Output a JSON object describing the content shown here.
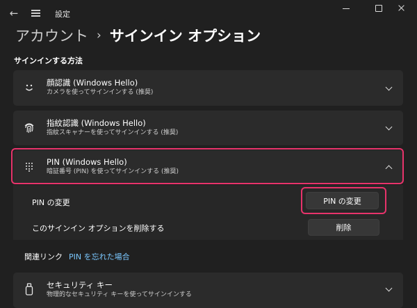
{
  "titlebar": {
    "back_icon": "back-arrow-icon",
    "menu_icon": "hamburger-menu-icon",
    "title": "設定"
  },
  "breadcrumb": {
    "parent": "アカウント",
    "separator": "›",
    "current": "サインイン オプション"
  },
  "section": {
    "title": "サインインする方法"
  },
  "methods": [
    {
      "icon": "face-icon",
      "title": "顔認識 (Windows Hello)",
      "subtitle": "カメラを使ってサインインする (推奨)",
      "expanded": false
    },
    {
      "icon": "fingerprint-icon",
      "title": "指紋認識 (Windows Hello)",
      "subtitle": "指紋スキャナーを使ってサインインする (推奨)",
      "expanded": false
    },
    {
      "icon": "pin-keypad-icon",
      "title": "PIN (Windows Hello)",
      "subtitle": "暗証番号 (PIN) を使ってサインインする (推奨)",
      "expanded": true,
      "rows": [
        {
          "label": "PIN の変更",
          "button": "PIN の変更"
        },
        {
          "label": "このサインイン オプションを削除する",
          "button": "削除"
        }
      ]
    },
    {
      "icon": "security-key-icon",
      "title": "セキュリティ キー",
      "subtitle": "物理的なセキュリティ キーを使ってサインインする",
      "expanded": false
    }
  ],
  "related": {
    "label": "関連リンク",
    "link": "PIN を忘れた場合"
  },
  "colors": {
    "background": "#202020",
    "card": "#2b2b2b",
    "highlight": "#e8336b",
    "link": "#7bc8ff"
  }
}
